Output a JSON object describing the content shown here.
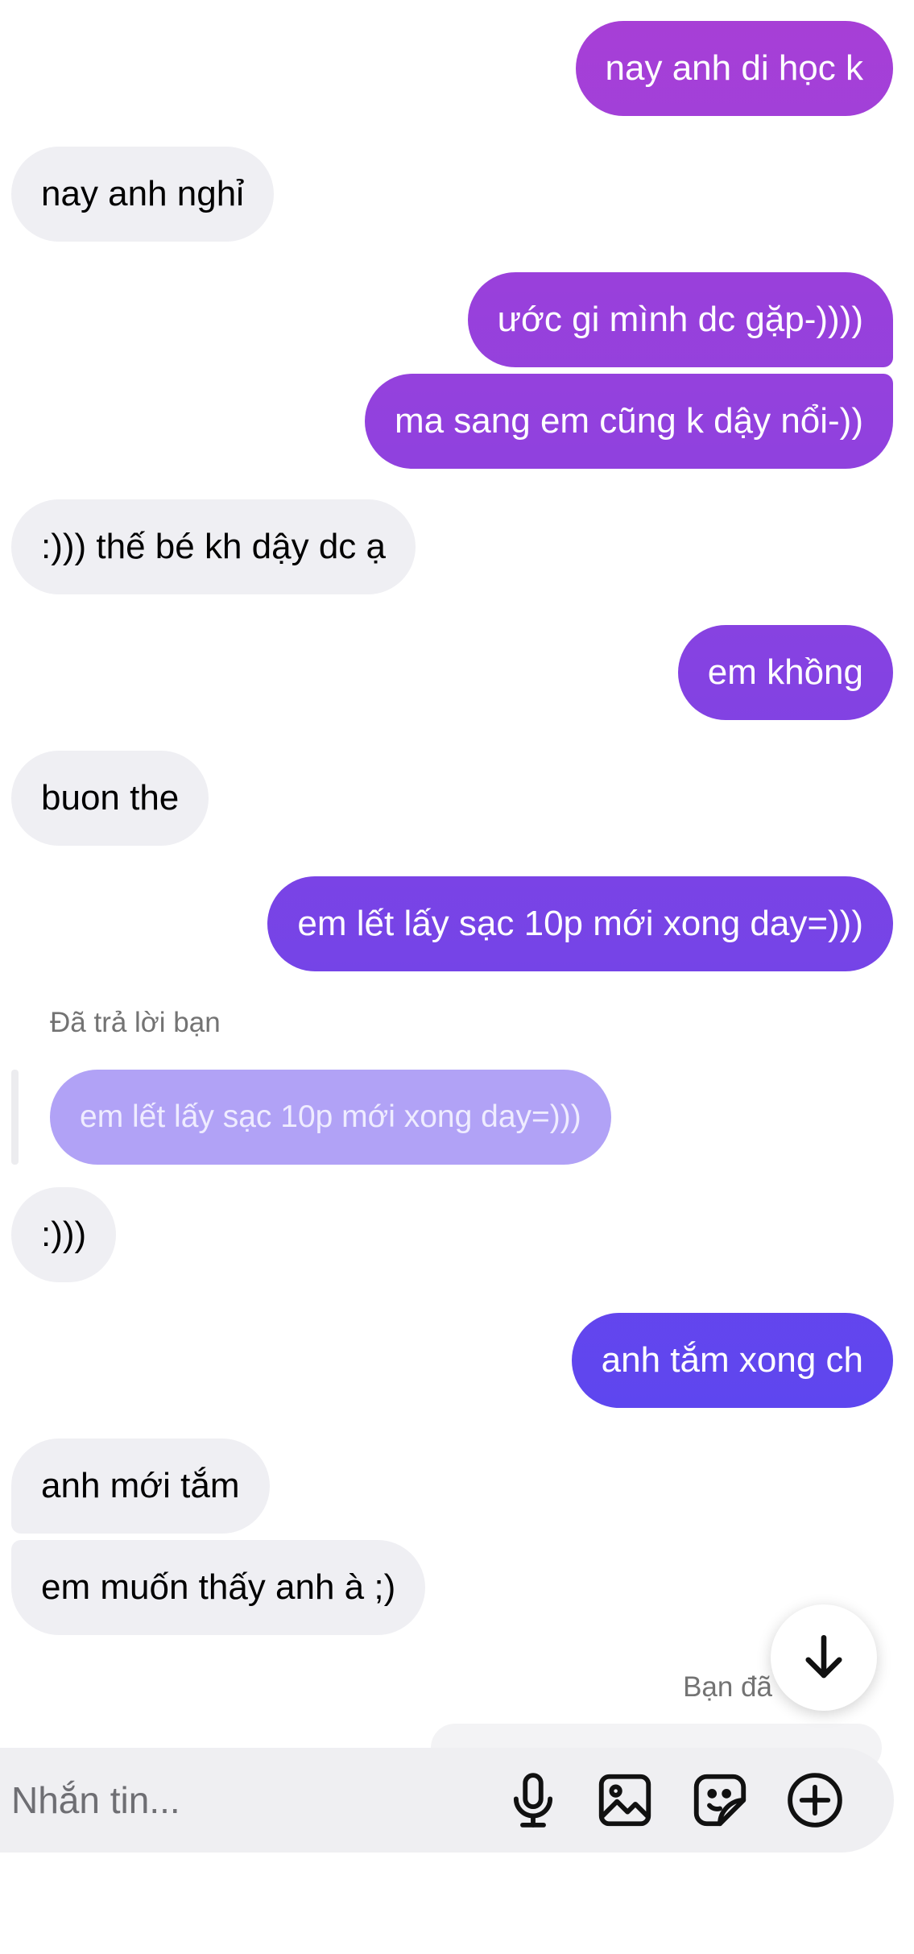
{
  "colors": {
    "incoming_bubble": "#efeff3",
    "outgoing_gradient_top": "#a83fd6",
    "outgoing_gradient_bottom": "#5b46f0",
    "reply_quote": "#b1a2f6",
    "meta_text": "#737373"
  },
  "messages": [
    {
      "side": "out",
      "text": "nay anh di học k"
    },
    {
      "side": "in",
      "text": "nay anh nghỉ"
    },
    {
      "side": "out",
      "text": "ước gi mình dc gặp-))))"
    },
    {
      "side": "out",
      "text": "ma sang em cũng k dậy nổi-))"
    },
    {
      "side": "in",
      "text": ":))) thế bé kh dậy dc ạ"
    },
    {
      "side": "out",
      "text": "em khồng"
    },
    {
      "side": "in",
      "text": "buon the"
    },
    {
      "side": "out",
      "text": "em lết lấy sạc 10p mới xong day=)))"
    },
    {
      "side": "in",
      "text": ":)))"
    },
    {
      "side": "out",
      "text": "anh tắm xong ch"
    },
    {
      "side": "in",
      "text": "anh mới tắm"
    },
    {
      "side": "in",
      "text": "em muốn thấy anh à ;)"
    }
  ],
  "reply": {
    "label": "Đã trả lời bạn",
    "quoted_text": "em lết lấy sạc 10p mới xong day=)))"
  },
  "seen_text": "Bạn đã",
  "composer": {
    "placeholder": "Nhắn tin...",
    "value": "",
    "icons": [
      "microphone-icon",
      "image-icon",
      "sticker-icon",
      "plus-circle-icon"
    ]
  },
  "scroll_button": {
    "icon": "arrow-down-icon"
  }
}
